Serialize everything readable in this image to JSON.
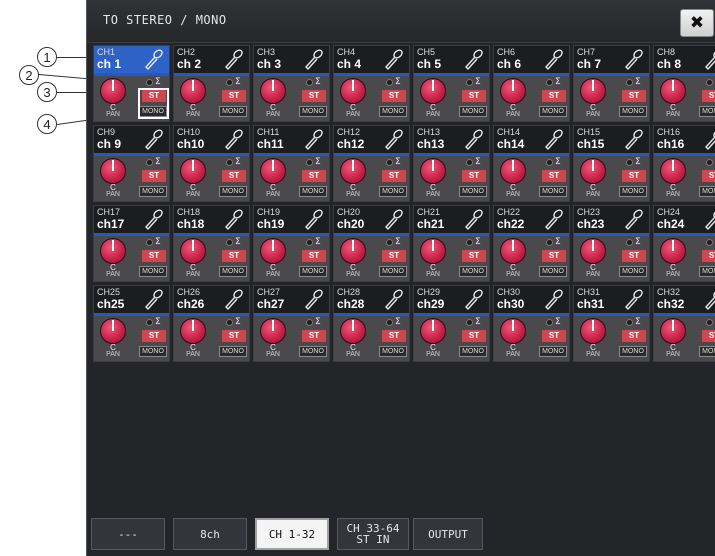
{
  "window": {
    "title": "TO STEREO / MONO",
    "close_label": "✖"
  },
  "callouts": [
    "1",
    "2",
    "3",
    "4"
  ],
  "channels": [
    {
      "id": "CH1",
      "name": "ch 1"
    },
    {
      "id": "CH2",
      "name": "ch 2"
    },
    {
      "id": "CH3",
      "name": "ch 3"
    },
    {
      "id": "CH4",
      "name": "ch 4"
    },
    {
      "id": "CH5",
      "name": "ch 5"
    },
    {
      "id": "CH6",
      "name": "ch 6"
    },
    {
      "id": "CH7",
      "name": "ch 7"
    },
    {
      "id": "CH8",
      "name": "ch 8"
    },
    {
      "id": "CH9",
      "name": "ch 9"
    },
    {
      "id": "CH10",
      "name": "ch10"
    },
    {
      "id": "CH11",
      "name": "ch11"
    },
    {
      "id": "CH12",
      "name": "ch12"
    },
    {
      "id": "CH13",
      "name": "ch13"
    },
    {
      "id": "CH14",
      "name": "ch14"
    },
    {
      "id": "CH15",
      "name": "ch15"
    },
    {
      "id": "CH16",
      "name": "ch16"
    },
    {
      "id": "CH17",
      "name": "ch17"
    },
    {
      "id": "CH18",
      "name": "ch18"
    },
    {
      "id": "CH19",
      "name": "ch19"
    },
    {
      "id": "CH20",
      "name": "ch20"
    },
    {
      "id": "CH21",
      "name": "ch21"
    },
    {
      "id": "CH22",
      "name": "ch22"
    },
    {
      "id": "CH23",
      "name": "ch23"
    },
    {
      "id": "CH24",
      "name": "ch24"
    },
    {
      "id": "CH25",
      "name": "ch25"
    },
    {
      "id": "CH26",
      "name": "ch26"
    },
    {
      "id": "CH27",
      "name": "ch27"
    },
    {
      "id": "CH28",
      "name": "ch28"
    },
    {
      "id": "CH29",
      "name": "ch29"
    },
    {
      "id": "CH30",
      "name": "ch30"
    },
    {
      "id": "CH31",
      "name": "ch31"
    },
    {
      "id": "CH32",
      "name": "ch32"
    }
  ],
  "selected_channel": "CH1",
  "strip": {
    "pan_value": "C",
    "pan_label": "PAN",
    "st_label": "ST",
    "mono_label": "MONO",
    "sum_icon": "Σ"
  },
  "tabs": [
    {
      "label": "---",
      "active": false
    },
    {
      "label": "8ch",
      "active": false
    },
    {
      "label": "CH 1-32",
      "active": true
    },
    {
      "label": "CH 33-64\nST IN",
      "active": false
    },
    {
      "label": "OUTPUT",
      "active": false
    }
  ],
  "colors": {
    "selected_header": "#2f62c7",
    "channel_strip": "#2b55c4",
    "pan_knob": "#c8234a",
    "st_button": "#d44552"
  }
}
